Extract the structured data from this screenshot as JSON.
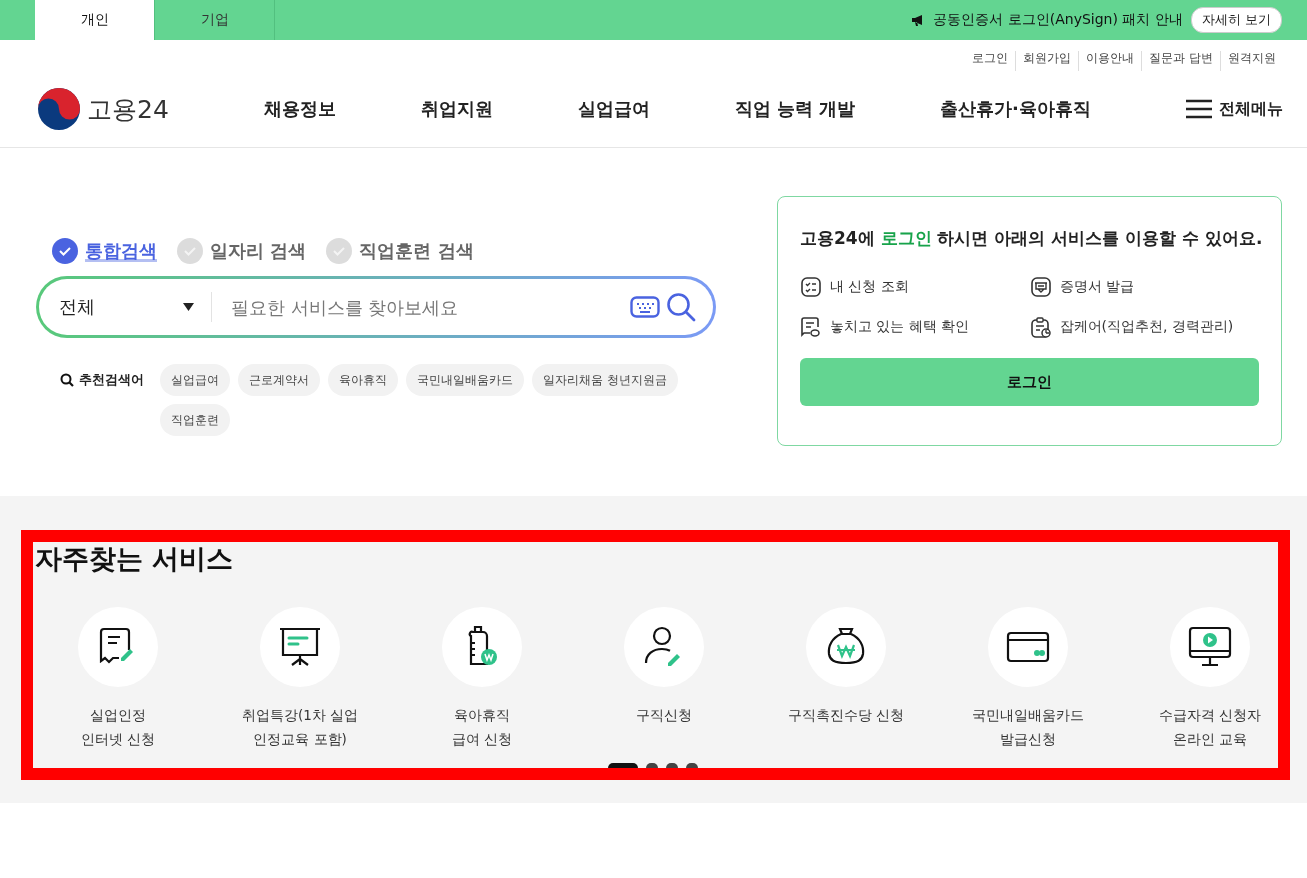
{
  "top_bar": {
    "tabs": [
      {
        "label": "개인",
        "selected": true
      },
      {
        "label": "기업",
        "selected": false
      }
    ],
    "notice": "공동인증서 로그인(AnySign) 패치 안내",
    "notice_button": "자세히 보기"
  },
  "util_links": [
    "로그인",
    "회원가입",
    "이용안내",
    "질문과 답변",
    "원격지원"
  ],
  "header": {
    "logo_text": "고용24",
    "nav": [
      "채용정보",
      "취업지원",
      "실업급여",
      "직업 능력 개발",
      "출산휴가·육아휴직"
    ],
    "menu_label": "전체메뉴"
  },
  "search": {
    "types": [
      {
        "label": "통합검색",
        "selected": true
      },
      {
        "label": "일자리 검색",
        "selected": false
      },
      {
        "label": "직업훈련 검색",
        "selected": false
      }
    ],
    "category": "전체",
    "placeholder": "필요한 서비스를 찾아보세요",
    "recommend_label": "추천검색어",
    "keywords": [
      "실업급여",
      "근로계약서",
      "육아휴직",
      "국민내일배움카드",
      "일자리채움 청년지원금",
      "직업훈련"
    ]
  },
  "login_card": {
    "title_lead": "고용24에 ",
    "title_highlight": "로그인",
    "title_rest": " 하시면 아래의 서비스를 이용할 수 있어요.",
    "features": [
      "내 신청 조회",
      "증명서 발급",
      "놓치고 있는 혜택 확인",
      "잡케어(직업추천, 경력관리)"
    ],
    "button": "로그인"
  },
  "services": {
    "title": "자주찾는 서비스",
    "highlighted": true,
    "items": [
      "실업인정\n인터넷 신청",
      "취업특강(1차 실업\n인정교육 포함)",
      "육아휴직\n급여 신청",
      "구직신청",
      "구직촉진수당 신청",
      "국민내일배움카드\n발급신청",
      "수급자격 신청자\n온라인 교육"
    ],
    "pages": [
      {
        "selected": true
      },
      {
        "selected": false
      },
      {
        "selected": false
      },
      {
        "selected": false
      }
    ]
  }
}
